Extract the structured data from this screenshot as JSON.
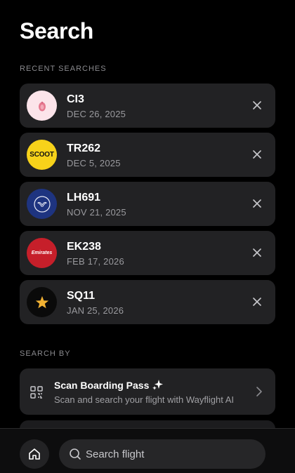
{
  "page": {
    "title": "Search"
  },
  "recent": {
    "label": "RECENT SEARCHES",
    "items": [
      {
        "flight": "CI3",
        "date": "DEC 26, 2025",
        "logo": "china-airlines-plum-blossom-icon",
        "color": "#fce4ea"
      },
      {
        "flight": "TR262",
        "date": "DEC 5, 2025",
        "logo": "scoot-logo",
        "logo_text": "SCOOT",
        "color": "#f7d21a"
      },
      {
        "flight": "LH691",
        "date": "NOV 21, 2025",
        "logo": "lufthansa-crane-icon",
        "color": "#1e3480"
      },
      {
        "flight": "EK238",
        "date": "FEB 17, 2026",
        "logo": "emirates-logo",
        "logo_text": "Emirates",
        "color": "#c61f2a"
      },
      {
        "flight": "SQ11",
        "date": "JAN 25, 2026",
        "logo": "singapore-airlines-star-icon",
        "color": "#0a0a0a"
      }
    ]
  },
  "search_by": {
    "label": "SEARCH BY",
    "scan": {
      "title": "Scan Boarding Pass",
      "subtitle": "Scan and search your flight with Wayflight AI"
    }
  },
  "bottom": {
    "search_placeholder": "Search flight"
  }
}
